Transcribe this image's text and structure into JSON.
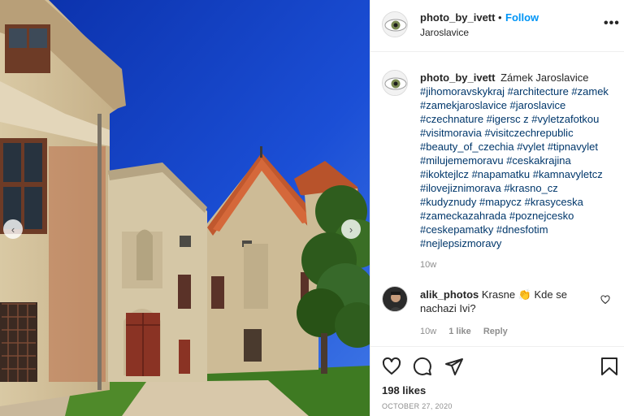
{
  "post": {
    "author": "photo_by_ivett",
    "follow_label": "Follow",
    "dot": "•",
    "location": "Jaroslavice",
    "more_icon": "more-options-icon",
    "more_label": "•••"
  },
  "caption": {
    "author": "photo_by_ivett",
    "text": "Zámek Jaroslavice",
    "hashtags": "#jihomoravskykraj #architecture #zamek #zamekjaroslavice #jaroslavice #czechnature #igersc z #vyletzafotkou #visitmoravia #visitczechrepublic #beauty_of_czechia #vylet #tipnavylet #milujememoravu #ceskakrajina #ikoktejlcz #napamatku #kamnavyletcz #ilovejiznimorava #krasno_cz #kudyznudy #mapycz #krasyceska #zameckazahrada #poznejcesko #ceskepamatky #dnesfotim #nejlepsizmoravy",
    "time": "10w"
  },
  "comment": {
    "author": "alik_photos",
    "text": "Krasne 👏 Kde se nachazi Ivi?",
    "time": "10w",
    "likes": "1 like",
    "reply": "Reply"
  },
  "footer": {
    "likes": "198 likes",
    "date": "October 27, 2020"
  },
  "colors": {
    "link": "#00376b",
    "follow": "#0095f6",
    "sky": "#1447c9"
  },
  "icons": [
    "heart-icon",
    "comment-icon",
    "share-icon",
    "bookmark-icon",
    "chevron-left-icon",
    "chevron-right-icon"
  ]
}
